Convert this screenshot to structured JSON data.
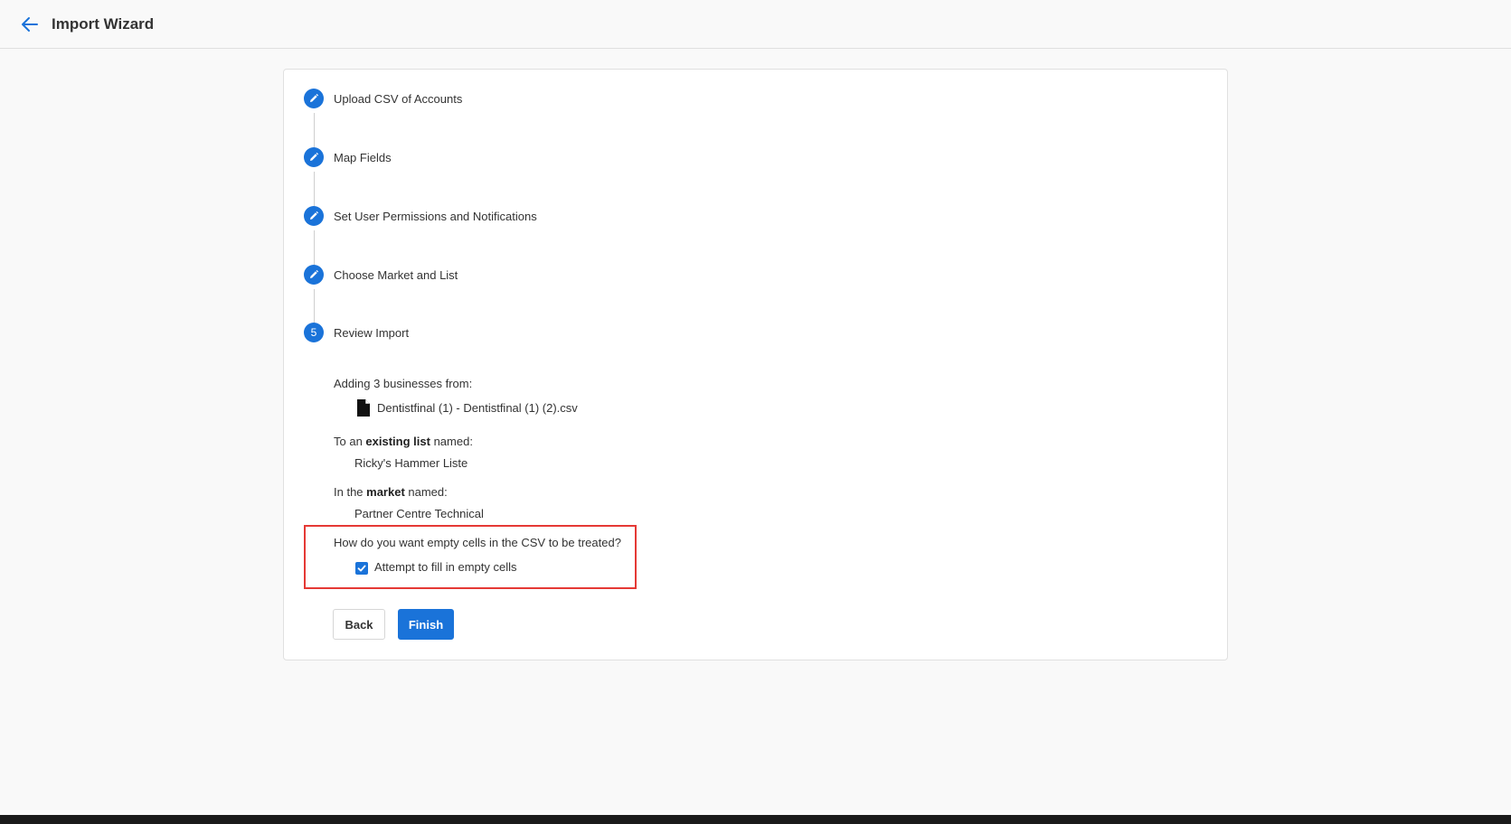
{
  "header": {
    "title": "Import Wizard"
  },
  "steps": [
    {
      "label": "Upload CSV of Accounts",
      "state": "completed",
      "icon": "pencil-icon"
    },
    {
      "label": "Map Fields",
      "state": "completed",
      "icon": "pencil-icon"
    },
    {
      "label": "Set User Permissions and Notifications",
      "state": "completed",
      "icon": "pencil-icon"
    },
    {
      "label": "Choose Market and List",
      "state": "completed",
      "icon": "pencil-icon"
    },
    {
      "label": "Review Import",
      "state": "current",
      "number": "5"
    }
  ],
  "review": {
    "adding_text": "Adding 3 businesses from:",
    "file_name": "Dentistfinal (1) - Dentistfinal (1) (2).csv",
    "list_prefix": "To an ",
    "list_bold": "existing list",
    "list_suffix": " named:",
    "list_name": "Ricky's Hammer Liste",
    "market_prefix": "In the ",
    "market_bold": "market",
    "market_suffix": " named:",
    "market_name": "Partner Centre Technical",
    "empty_cells_question": "How do you want empty cells in the CSV to be treated?",
    "fill_empty_label": "Attempt to fill in empty cells",
    "fill_empty_checked": true
  },
  "buttons": {
    "back_label": "Back",
    "finish_label": "Finish"
  },
  "colors": {
    "accent": "#1a73d9",
    "highlight_border": "#e53935"
  }
}
